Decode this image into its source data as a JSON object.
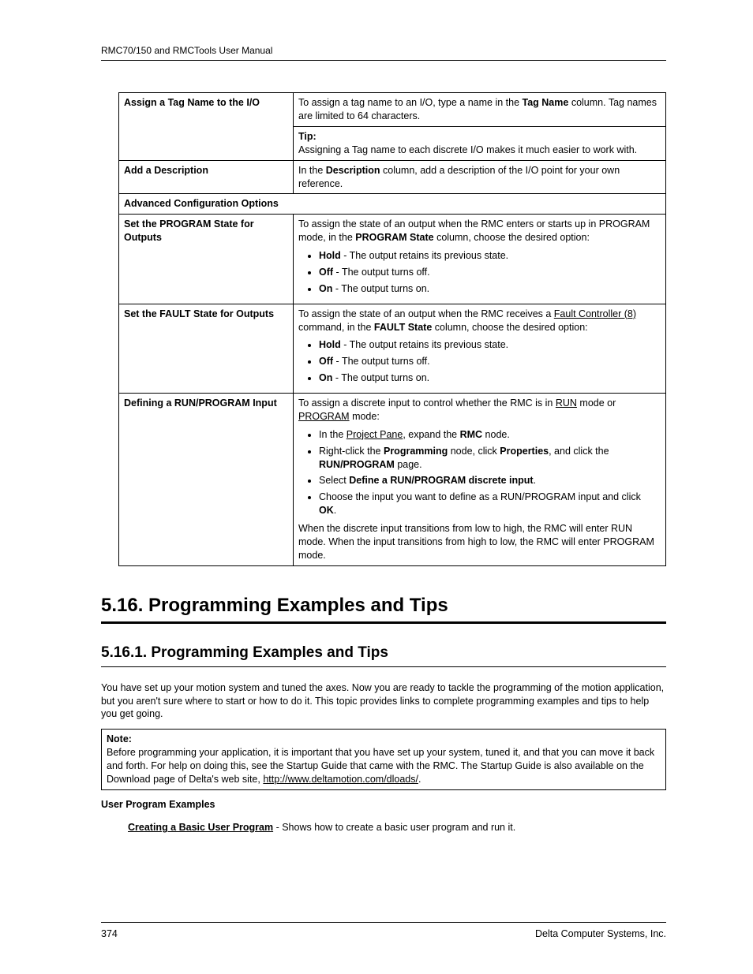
{
  "header": {
    "title": "RMC70/150 and RMCTools User Manual"
  },
  "table": {
    "row1": {
      "label": "Assign a Tag Name to the I/O",
      "c1a": "To assign a tag name to an I/O, type a name in the ",
      "c1b": "Tag Name",
      "c1c": " column. Tag names are limited to 64 characters.",
      "tip_label": "Tip:",
      "tip_text": "Assigning a Tag name to each discrete I/O makes it much easier to work with."
    },
    "row2": {
      "label": "Add a Description",
      "c1a": "In the ",
      "c1b": "Description",
      "c1c": " column, add a description of the I/O point for your own reference."
    },
    "advanced_header": "Advanced Configuration Options",
    "row3": {
      "label": "Set the PROGRAM State for Outputs",
      "p1a": "To assign the state of an output when the RMC enters or starts up in PROGRAM mode, in the ",
      "p1b": "PROGRAM State",
      "p1c": " column, choose the desired option:",
      "li1a": "Hold",
      "li1b": " - The output retains its previous state.",
      "li2a": "Off",
      "li2b": " - The output turns off.",
      "li3a": "On",
      "li3b": " - The output turns on."
    },
    "row4": {
      "label": "Set the FAULT State for Outputs",
      "p1a": "To assign the state of an output when the RMC receives a ",
      "p1b": "Fault Controller (8)",
      "p1c": " command, in the ",
      "p1d": "FAULT State",
      "p1e": " column, choose the desired option:",
      "li1a": "Hold",
      "li1b": " - The output retains its previous state.",
      "li2a": "Off",
      "li2b": " - The output turns off.",
      "li3a": "On",
      "li3b": " - The output turns on."
    },
    "row5": {
      "label": "Defining a RUN/PROGRAM Input",
      "p1a": "To assign a discrete input to control whether the RMC is in ",
      "p1b": "RUN",
      "p1c": " mode or ",
      "p1d": "PROGRAM",
      "p1e": " mode:",
      "li1a": "In the ",
      "li1b": "Project Pane",
      "li1c": ", expand the ",
      "li1d": "RMC",
      "li1e": " node.",
      "li2a": "Right-click the ",
      "li2b": "Programming",
      "li2c": " node, click ",
      "li2d": "Properties",
      "li2e": ", and click the ",
      "li2f": "RUN/PROGRAM",
      "li2g": " page.",
      "li3a": "Select ",
      "li3b": "Define a RUN/PROGRAM discrete input",
      "li3c": ".",
      "li4a": "Choose the input you want to define as a RUN/PROGRAM input and click ",
      "li4b": "OK",
      "li4c": ".",
      "p2": "When the discrete input transitions from low to high, the RMC will enter RUN mode. When the input transitions from high to low, the RMC will enter PROGRAM mode."
    }
  },
  "section": {
    "h2": "5.16. Programming Examples and Tips",
    "h3": "5.16.1. Programming Examples and Tips",
    "intro": "You have set up your motion system and tuned the axes. Now you are ready to tackle the programming of the motion application, but you aren't sure where to start or how to do it. This topic provides links to complete programming examples and tips to help you get going.",
    "note_label": "Note:",
    "note_a": "Before programming your application, it is important that you have set up your system, tuned it, and that you can move it back and forth. For help on doing this, see the Startup Guide that came with the RMC. The Startup Guide is also available on the Download page of Delta's web site, ",
    "note_link": "http://www.deltamotion.com/dloads/",
    "note_b": ".",
    "subhead": "User Program Examples",
    "link1": "Creating a Basic User Program",
    "link1_rest": " - Shows how to create a basic user program and run it."
  },
  "footer": {
    "page": "374",
    "company": "Delta Computer Systems, Inc."
  }
}
